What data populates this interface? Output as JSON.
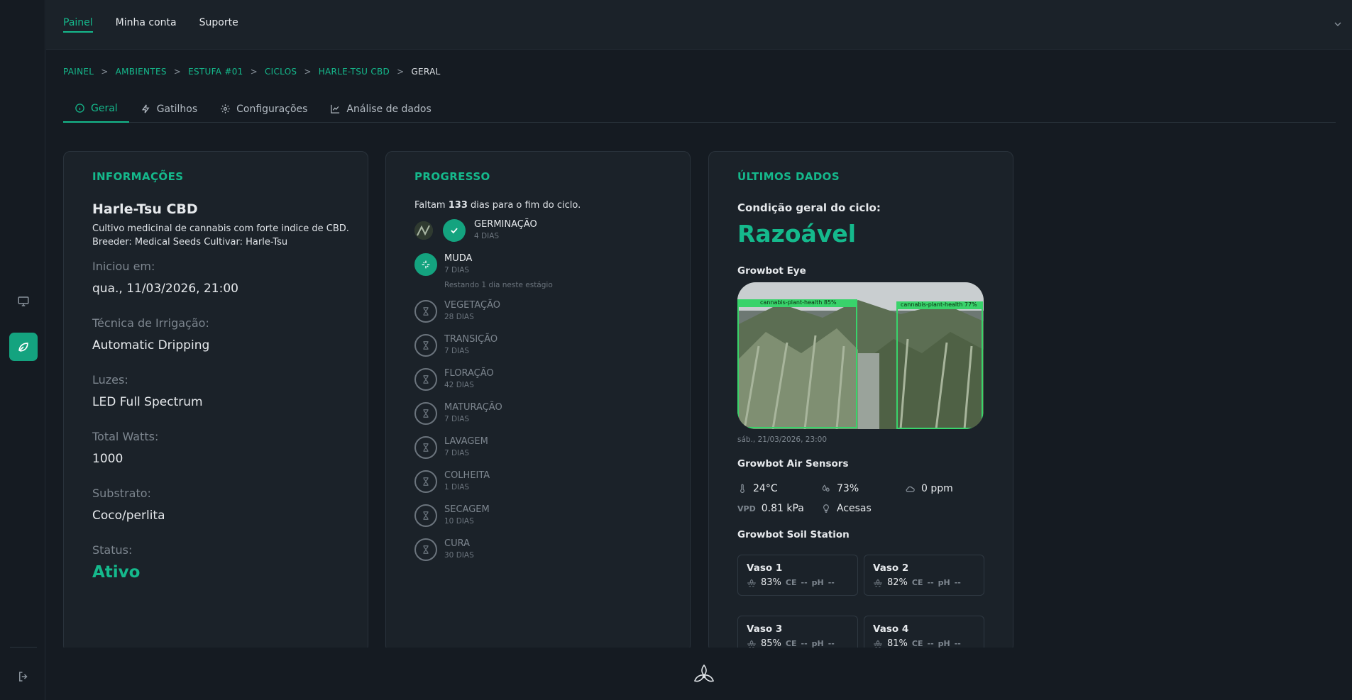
{
  "topnav": {
    "items": [
      "Painel",
      "Minha conta",
      "Suporte"
    ]
  },
  "breadcrumb": {
    "items": [
      "PAINEL",
      "AMBIENTES",
      "ESTUFA #01",
      "CICLOS",
      "HARLE-TSU CBD"
    ],
    "current": "GERAL",
    "separator": ">"
  },
  "tabs": [
    "Geral",
    "Gatilhos",
    "Configurações",
    "Análise de dados"
  ],
  "info": {
    "heading": "INFORMAÇÕES",
    "name": "Harle-Tsu CBD",
    "desc": "Cultivo medicinal de cannabis com forte indice de CBD.",
    "breeder": "Breeder: Medical Seeds Cultivar: Harle-Tsu",
    "fields": [
      {
        "label": "Iniciou em:",
        "value": "qua., 11/03/2026, 21:00"
      },
      {
        "label": "Técnica de Irrigação:",
        "value": "Automatic Dripping"
      },
      {
        "label": "Luzes:",
        "value": "LED Full Spectrum"
      },
      {
        "label": "Total Watts:",
        "value": "1000"
      },
      {
        "label": "Substrato:",
        "value": "Coco/perlita"
      }
    ],
    "status_label": "Status:",
    "status_value": "Ativo"
  },
  "progress": {
    "heading": "PROGRESSO",
    "remaining_pre": "Faltam",
    "remaining_days": "133",
    "remaining_post": "dias para o fim do ciclo.",
    "stages": [
      {
        "name": "GERMINAÇÃO",
        "days": "4 DIAS"
      },
      {
        "name": "MUDA",
        "days": "7 DIAS",
        "note": "Restando 1 dia neste estágio"
      },
      {
        "name": "VEGETAÇÃO",
        "days": "28 DIAS"
      },
      {
        "name": "TRANSIÇÃO",
        "days": "7 DIAS"
      },
      {
        "name": "FLORAÇÃO",
        "days": "42 DIAS"
      },
      {
        "name": "MATURAÇÃO",
        "days": "7 DIAS"
      },
      {
        "name": "LAVAGEM",
        "days": "7 DIAS"
      },
      {
        "name": "COLHEITA",
        "days": "1 DIAS"
      },
      {
        "name": "SECAGEM",
        "days": "10 DIAS"
      },
      {
        "name": "CURA",
        "days": "30 DIAS"
      }
    ]
  },
  "latest": {
    "heading": "ÚLTIMOS DADOS",
    "condition_label": "Condição geral do ciclo:",
    "condition_value": "Razoável",
    "eye_title": "Growbot Eye",
    "eye_tags": [
      "cannabis-plant-health 85%",
      "cannabis-plant-health 77%"
    ],
    "eye_time": "sáb., 21/03/2026, 23:00",
    "air_title": "Growbot Air Sensors",
    "air": {
      "temp": "24°C",
      "humidity": "73%",
      "co2": "0 ppm",
      "vpd_label": "VPD",
      "vpd": "0.81 kPa",
      "lights": "Acesas"
    },
    "soil_title": "Growbot Soil Station",
    "vasos": [
      {
        "name": "Vaso 1",
        "moisture": "83%",
        "ce_label": "CE",
        "ce": "--",
        "ph_label": "pH",
        "ph": "--"
      },
      {
        "name": "Vaso 2",
        "moisture": "82%",
        "ce_label": "CE",
        "ce": "--",
        "ph_label": "pH",
        "ph": "--"
      },
      {
        "name": "Vaso 3",
        "moisture": "85%",
        "ce_label": "CE",
        "ce": "--",
        "ph_label": "pH",
        "ph": "--"
      },
      {
        "name": "Vaso 4",
        "moisture": "81%",
        "ce_label": "CE",
        "ce": "--",
        "ph_label": "pH",
        "ph": "--"
      }
    ]
  },
  "colors": {
    "accent": "#15b98c",
    "background": "#151b22",
    "card": "#1b2229"
  }
}
